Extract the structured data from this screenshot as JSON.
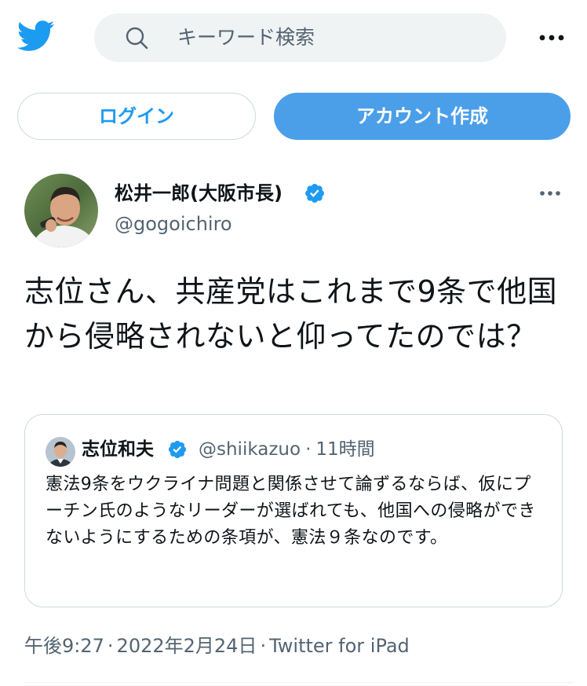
{
  "header": {
    "logo_icon": "twitter-bird-icon",
    "search": {
      "icon": "search-icon",
      "placeholder": "キーワード検索"
    },
    "more_icon": "more-horizontal-icon"
  },
  "auth": {
    "login_label": "ログイン",
    "signup_label": "アカウント作成"
  },
  "tweet": {
    "author": {
      "display_name": "松井一郎(大阪市長)",
      "handle": "@gogoichiro",
      "verified_icon": "verified-badge-icon"
    },
    "more_icon": "more-horizontal-icon",
    "text": "志位さん、共産党はこれまで9条で他国から侵略されないと仰ってたのでは？",
    "quote": {
      "author": {
        "display_name": "志位和夫",
        "handle": "@shiikazuo",
        "separator": "·",
        "time": "11時間",
        "verified_icon": "verified-badge-icon"
      },
      "text": "憲法9条をウクライナ問題と関係させて論ずるならば、仮にプーチン氏のようなリーダーが選ばれても、他国への侵略ができないようにするための条項が、憲法９条なのです。"
    },
    "meta": {
      "time": "午後9:27",
      "separator": "·",
      "date": "2022年2月24日",
      "source": "Twitter for iPad"
    }
  },
  "colors": {
    "accent": "#1d9bf0",
    "signup_bg": "#4b9fe9",
    "secondary_text": "#536471",
    "border": "#cfd9de"
  }
}
